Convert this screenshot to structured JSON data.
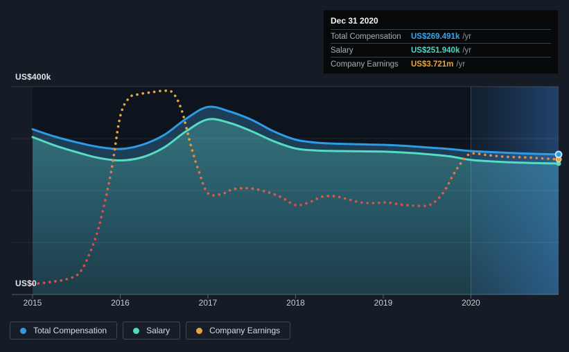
{
  "tooltip": {
    "date": "Dec 31 2020",
    "rows": [
      {
        "label": "Total Compensation",
        "value": "US$269.491k",
        "suffix": "/yr",
        "color": "#38a5e8"
      },
      {
        "label": "Salary",
        "value": "US$251.940k",
        "suffix": "/yr",
        "color": "#4ed8c2"
      },
      {
        "label": "Company Earnings",
        "value": "US$3.721m",
        "suffix": "/yr",
        "color": "#e8a43d"
      }
    ]
  },
  "legend": {
    "items": [
      {
        "label": "Total Compensation",
        "color": "#2e9be6"
      },
      {
        "label": "Salary",
        "color": "#4fdac4"
      },
      {
        "label": "Company Earnings",
        "color": "#e8a43d"
      }
    ]
  },
  "chart_data": {
    "type": "area",
    "x_axis": {
      "ticks": [
        "2015",
        "2016",
        "2017",
        "2018",
        "2019",
        "2020"
      ],
      "tick_years": [
        2015,
        2016,
        2017,
        2018,
        2019,
        2020
      ],
      "range": [
        2015,
        2021
      ]
    },
    "y_axis": {
      "label_top": "US$400k",
      "label_bottom": "US$0",
      "min_k": 0,
      "max_k": 400,
      "gridlines_k": [
        400,
        300,
        200,
        100
      ]
    },
    "highlight_region": {
      "from_year": 2020,
      "to_year": 2021,
      "meaning": "hovered period shown in tooltip"
    },
    "series": [
      {
        "name": "Total Compensation",
        "style": "solid",
        "color": "#2e9be6",
        "unit": "US$ thousands / yr",
        "x": [
          2015,
          2015.25,
          2015.5,
          2015.75,
          2016,
          2016.25,
          2016.5,
          2016.75,
          2017,
          2017.25,
          2017.5,
          2017.75,
          2018,
          2018.25,
          2018.5,
          2018.75,
          2019,
          2019.25,
          2019.5,
          2019.75,
          2020,
          2020.25,
          2020.5,
          2020.75,
          2021
        ],
        "values_k": [
          318,
          304,
          293,
          284,
          280,
          288,
          307,
          338,
          361,
          352,
          336,
          314,
          298,
          292,
          290,
          289,
          288,
          286,
          283,
          280,
          276,
          274,
          272,
          270.5,
          269.491
        ],
        "end_value": "US$269.491k"
      },
      {
        "name": "Salary",
        "style": "solid",
        "color": "#57dcc4",
        "unit": "US$ thousands / yr",
        "x": [
          2015,
          2015.25,
          2015.5,
          2015.75,
          2016,
          2016.25,
          2016.5,
          2016.75,
          2017,
          2017.25,
          2017.5,
          2017.75,
          2018,
          2018.25,
          2018.5,
          2018.75,
          2019,
          2019.25,
          2019.5,
          2019.75,
          2020,
          2020.25,
          2020.5,
          2020.75,
          2021
        ],
        "values_k": [
          303,
          287,
          274,
          263,
          258,
          264,
          283,
          314,
          337,
          330,
          314,
          295,
          281,
          277,
          276,
          275.5,
          275,
          273,
          270,
          266,
          259,
          256,
          254,
          252.8,
          251.94
        ],
        "end_value": "US$251.940k"
      },
      {
        "name": "Company Earnings",
        "style": "dotted",
        "color_high": "#e8a43d",
        "color_low": "#e14b4b",
        "unit": "own hidden scale; values are axis-equivalent positions in US$k; Dec 31 2020 = US$3.721m",
        "x": [
          2015,
          2015.2,
          2015.4,
          2015.55,
          2015.7,
          2015.8,
          2015.9,
          2016,
          2016.1,
          2016.2,
          2016.35,
          2016.5,
          2016.6,
          2016.7,
          2016.8,
          2016.9,
          2017,
          2017.15,
          2017.3,
          2017.5,
          2017.7,
          2017.85,
          2018,
          2018.15,
          2018.3,
          2018.45,
          2018.6,
          2018.75,
          2018.9,
          2019.05,
          2019.2,
          2019.35,
          2019.5,
          2019.6,
          2019.7,
          2019.8,
          2019.9,
          2020,
          2020.2,
          2020.4,
          2020.6,
          2020.8,
          2021
        ],
        "values_k": [
          20,
          24,
          30,
          45,
          100,
          160,
          240,
          343,
          378,
          385,
          389,
          392,
          388,
          355,
          290,
          235,
          195,
          193,
          203,
          204,
          196,
          186,
          172,
          177,
          188,
          189,
          183,
          177,
          176,
          177,
          173,
          171,
          171,
          180,
          200,
          231,
          256,
          271,
          268,
          265,
          264,
          262,
          260
        ],
        "end_value": "US$3.721m"
      }
    ],
    "colors": {
      "page_bg": "#151c26",
      "plot_bg": "#0d141d",
      "band_fill": "#1d3e57",
      "area_top": "#316b75",
      "area_bottom": "#1d3c49"
    }
  }
}
